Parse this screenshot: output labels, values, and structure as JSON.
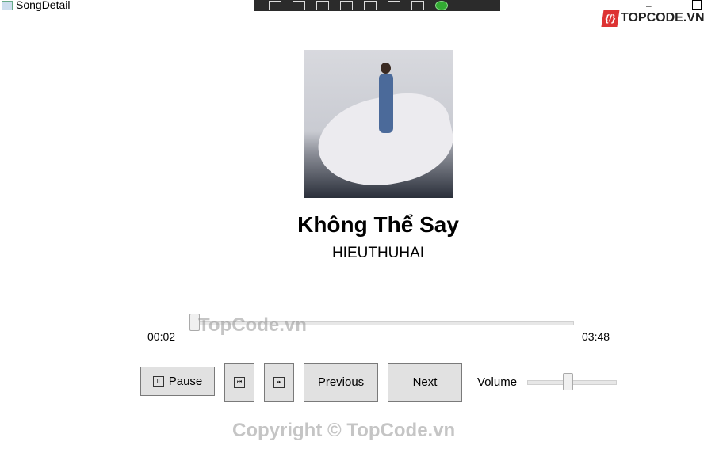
{
  "window": {
    "title": "SongDetail",
    "minimize": "–"
  },
  "logo": {
    "mark": "{/}",
    "text": "TOPCODE.VN"
  },
  "song": {
    "title": "Không Thể Say",
    "artist": "HIEUTHUHAI"
  },
  "playback": {
    "current_time": "00:02",
    "duration": "03:48",
    "progress_fraction": 0.009
  },
  "controls": {
    "pause": "Pause",
    "previous_track_icon": "⏮",
    "next_track_icon": "⏭",
    "previous": "Previous",
    "next": "Next",
    "volume_label": "Volume",
    "volume_fraction": 0.5
  },
  "watermarks": {
    "top": "TopCode.vn",
    "bottom": "Copyright © TopCode.vn"
  }
}
